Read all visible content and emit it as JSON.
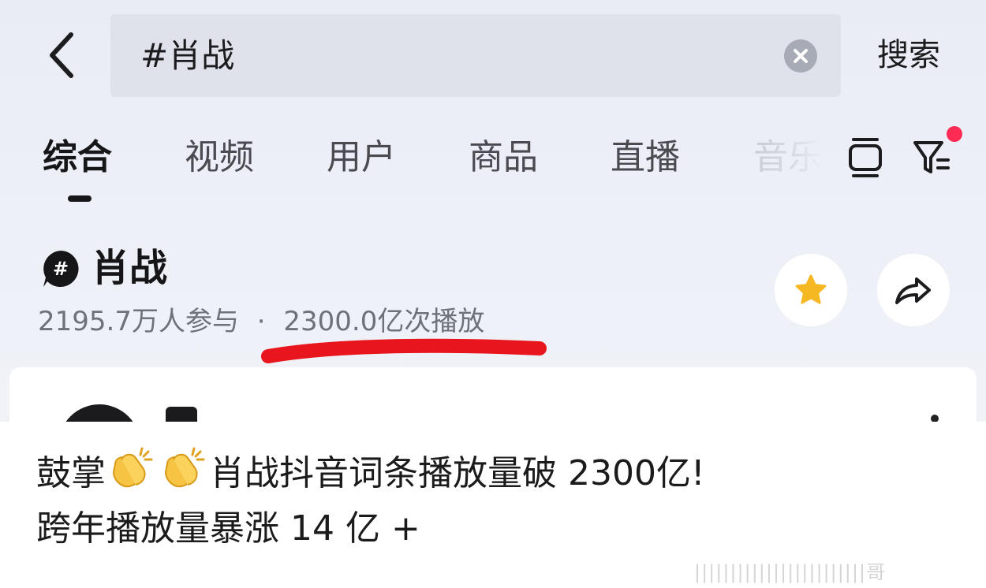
{
  "search": {
    "query": "#肖战",
    "submit_label": "搜索"
  },
  "tabs": [
    {
      "label": "综合",
      "active": true
    },
    {
      "label": "视频"
    },
    {
      "label": "用户"
    },
    {
      "label": "商品"
    },
    {
      "label": "直播"
    },
    {
      "label": "音乐"
    }
  ],
  "topic": {
    "title": "肖战",
    "participants": "2195.7万人参与",
    "separator": "·",
    "plays": "2300.0亿次播放"
  },
  "icons": {
    "back": "chevron-left-icon",
    "clear": "clear-icon",
    "layout": "list-view-icon",
    "filter": "filter-icon",
    "topic": "hashtag-icon",
    "favorite": "star-icon",
    "share": "share-icon"
  },
  "colors": {
    "accent_red": "#fe2c55",
    "underline_red": "#e8161c",
    "star_gold": "#f6b822"
  },
  "caption": {
    "line1_prefix": "鼓掌",
    "line1_text": "肖战抖音词条播放量破 2300亿!",
    "line2_text": "跨年播放量暴涨 14 亿 +"
  },
  "watermark": "||||||||||||||||||||||||哥"
}
